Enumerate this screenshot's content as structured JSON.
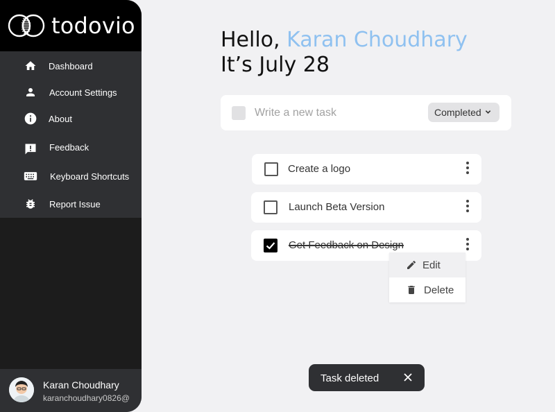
{
  "app": {
    "name": "todovio",
    "logo": "venn-logo-icon"
  },
  "sidebar": {
    "items": [
      {
        "label": "Dashboard",
        "icon": "home-icon"
      },
      {
        "label": "Account Settings",
        "icon": "person-icon"
      },
      {
        "label": "About",
        "icon": "info-icon"
      },
      {
        "label": "Feedback",
        "icon": "feedback-icon"
      },
      {
        "label": "Keyboard Shortcuts",
        "icon": "keyboard-icon"
      },
      {
        "label": "Report Issue",
        "icon": "bug-icon"
      }
    ]
  },
  "profile": {
    "name": "Karan Choudhary",
    "email": "karanchoudhary0826@"
  },
  "greeting": {
    "hello": "Hello, ",
    "name": "Karan Choudhary",
    "date": "It’s July 28"
  },
  "new_task": {
    "placeholder": "Write a new task",
    "value": "",
    "filter_label": "Completed"
  },
  "tasks": [
    {
      "label": "Create a logo",
      "done": false
    },
    {
      "label": "Launch Beta Version",
      "done": false
    },
    {
      "label": "Get Feedback on Design",
      "done": true
    }
  ],
  "context_menu": {
    "edit": "Edit",
    "delete": "Delete"
  },
  "toast": {
    "message": "Task deleted"
  },
  "colors": {
    "accent_name": "#8fc1f0",
    "sidebar_bg": "#1c1c1c",
    "nav_bg": "#2f3033",
    "page_bg": "#f1f1f3"
  }
}
